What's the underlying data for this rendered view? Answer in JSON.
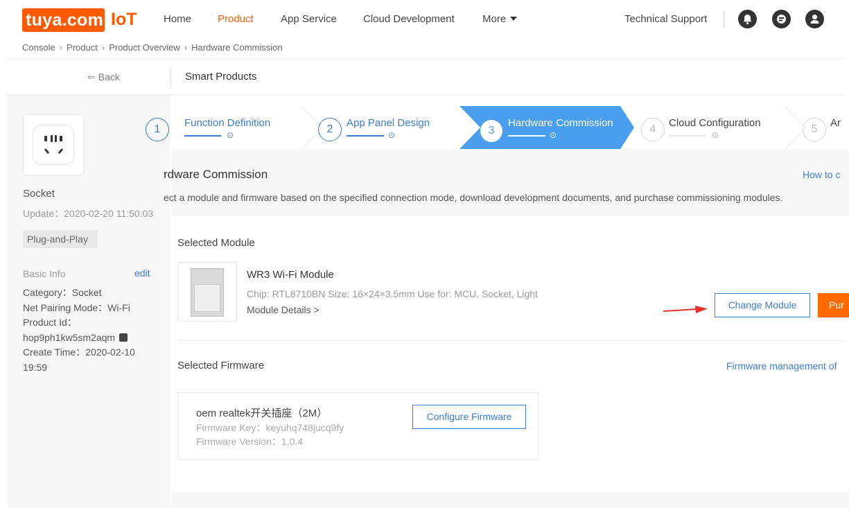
{
  "header": {
    "logo_text": "tuya.com",
    "brand_suffix": "IoT",
    "nav": [
      "Home",
      "Product",
      "App Service",
      "Cloud Development",
      "More"
    ],
    "active_nav": "Product",
    "support": "Technical Support",
    "icons": [
      "bell-icon",
      "message-icon",
      "user-icon"
    ]
  },
  "breadcrumb": [
    "Console",
    "Product",
    "Product Overview",
    "Hardware Commission"
  ],
  "subheader": {
    "back": "Back",
    "title": "Smart Products"
  },
  "product": {
    "name": "Socket",
    "update": "Update：2020-02-20 11:50:03",
    "tag": "Plug-and-Play",
    "basic_info_label": "Basic Info",
    "edit_label": "edit",
    "category": "Category：Socket",
    "pairing": "Net Pairing Mode：Wi-Fi",
    "product_id_label": "Product Id：",
    "product_id": "hop9ph1kw5sm2aqm",
    "create_time_1": "Create Time：2020-02-10",
    "create_time_2": "19:59"
  },
  "steps": [
    {
      "num": "1",
      "label": "Function Definition"
    },
    {
      "num": "2",
      "label": "App Panel Design"
    },
    {
      "num": "3",
      "label": "Hardware Commission"
    },
    {
      "num": "4",
      "label": "Cloud Configuration"
    },
    {
      "num": "5",
      "label": "Ar"
    }
  ],
  "section": {
    "title": "rdware Commission",
    "description": "ect a module and firmware based on the specified connection mode, download development documents, and purchase commissioning modules.",
    "how_to": "How to c"
  },
  "module": {
    "section_label": "Selected Module",
    "name": "WR3 Wi-Fi Module",
    "meta": "Chip: RTL8710BN  Size: 16×24×3.5mm  Use for: MCU,  Socket,  Light",
    "details_link": "Module Details >",
    "change_button": "Change Module",
    "purchase_button": "Pur"
  },
  "firmware": {
    "section_label": "Selected Firmware",
    "management_link": "Firmware management of",
    "name": "oem realtek开关插座（2M）",
    "key": "Firmware Key：keyuhq748jucq9fy",
    "version": "Firmware Version：1.0.4",
    "configure_button": "Configure Firmware"
  },
  "colors": {
    "brand": "#ff5a00",
    "accent": "#3a7bd5",
    "active_step_bg": "#4a9ef0",
    "arrow": "#e8302a"
  }
}
